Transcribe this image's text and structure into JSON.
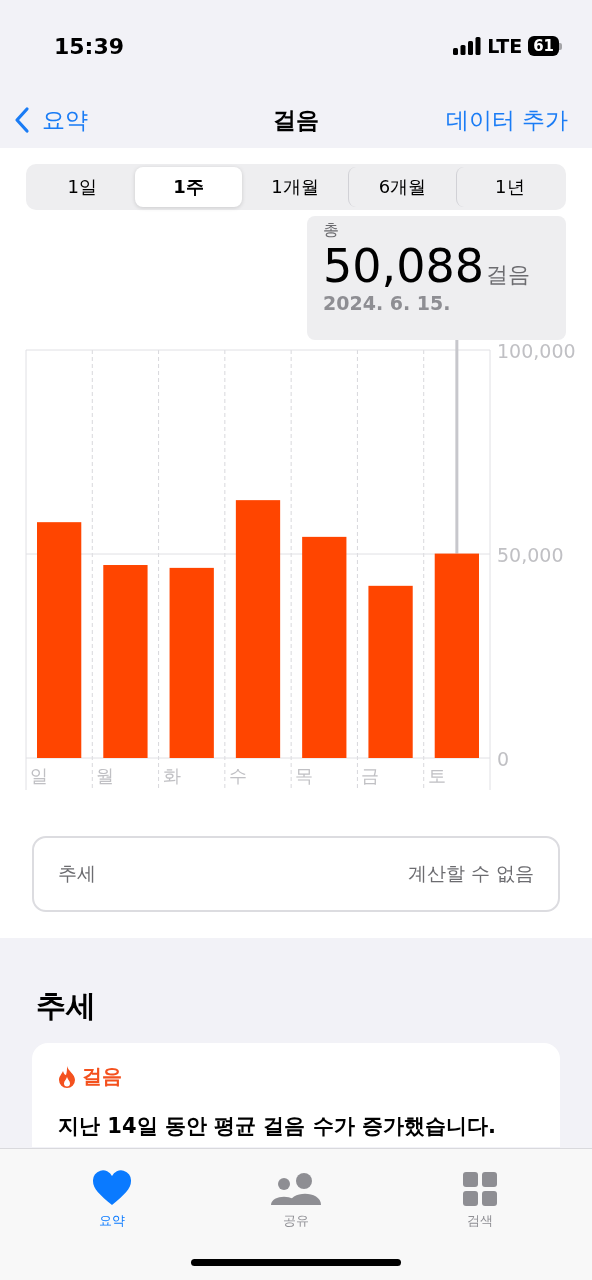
{
  "status_bar": {
    "time": "15:39",
    "network": "LTE",
    "battery": "61"
  },
  "nav": {
    "back": "요약",
    "title": "걸음",
    "action": "데이터 추가"
  },
  "segments": [
    {
      "label": "1일",
      "selected": false
    },
    {
      "label": "1주",
      "selected": true
    },
    {
      "label": "1개월",
      "selected": false
    },
    {
      "label": "6개월",
      "selected": false
    },
    {
      "label": "1년",
      "selected": false
    }
  ],
  "tooltip": {
    "label": "총",
    "value": "50,088",
    "unit": "걸음",
    "date": "2024. 6. 15."
  },
  "chart_data": {
    "type": "bar",
    "categories": [
      "일",
      "월",
      "화",
      "수",
      "목",
      "금",
      "토"
    ],
    "series": [
      {
        "color": "#ff4500",
        "values": [
          57800,
          47300,
          46600,
          63200,
          54200,
          42200,
          50100
        ]
      }
    ],
    "ylim": [
      0,
      100000
    ],
    "yticks": [
      {
        "value": 0,
        "label": "0"
      },
      {
        "value": 50000,
        "label": "50,000"
      },
      {
        "value": 100000,
        "label": "100,000"
      }
    ]
  },
  "trend_row": {
    "label": "추세",
    "value": "계산할 수 없음"
  },
  "trends": {
    "heading": "추세",
    "card_title": "걸음",
    "card_text": "지난 14일 동안 평균 걸음 수가 증가했습니다."
  },
  "tab_bar": [
    {
      "label": "요약",
      "selected": true,
      "kind": "heart"
    },
    {
      "label": "공유",
      "selected": false,
      "kind": "people"
    },
    {
      "label": "검색",
      "selected": false,
      "kind": "grid"
    }
  ]
}
